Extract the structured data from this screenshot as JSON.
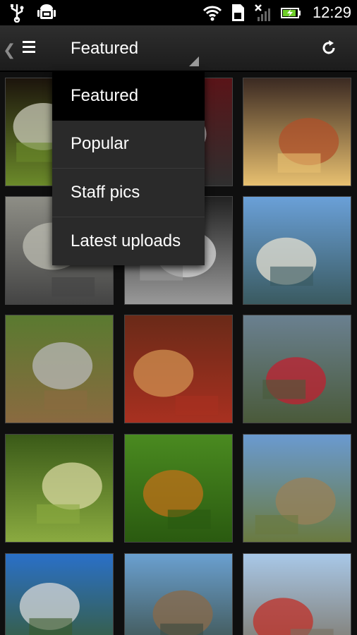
{
  "status_bar": {
    "time": "12:29",
    "icons": [
      "usb-icon",
      "android-debug-icon",
      "wifi-icon",
      "sd-card-icon",
      "signal-icon",
      "battery-charging-icon"
    ]
  },
  "action_bar": {
    "title": "Featured",
    "menu_icon": "menu-icon",
    "refresh_icon": "refresh-icon"
  },
  "dropdown": {
    "items": [
      {
        "label": "Featured",
        "selected": true
      },
      {
        "label": "Popular",
        "selected": false
      },
      {
        "label": "Staff pics",
        "selected": false
      },
      {
        "label": "Latest uploads",
        "selected": false
      }
    ]
  },
  "photos": [
    {
      "subject": "white flowers with ladybug",
      "colors": [
        "#1c140c",
        "#c9c9b8",
        "#6b8a2a"
      ]
    },
    {
      "subject": "butterfly",
      "colors": [
        "#5a1418",
        "#e8e8e8",
        "#2f2f2f"
      ]
    },
    {
      "subject": "beer on table",
      "colors": [
        "#3b2a22",
        "#b0502a",
        "#e8c070"
      ]
    },
    {
      "subject": "spider on rock",
      "colors": [
        "#8e8e86",
        "#bdbdb3",
        "#444"
      ]
    },
    {
      "subject": "angel statue",
      "colors": [
        "#222",
        "#d8d8d8",
        "#999"
      ]
    },
    {
      "subject": "boats on river",
      "colors": [
        "#6aa0d8",
        "#e6e0d0",
        "#3a5a60"
      ]
    },
    {
      "subject": "pigeon",
      "colors": [
        "#5a7a30",
        "#b8b8b8",
        "#8a6a40"
      ]
    },
    {
      "subject": "library staircase",
      "colors": [
        "#6a2a18",
        "#d09050",
        "#a83020"
      ]
    },
    {
      "subject": "red scooter",
      "colors": [
        "#6a8090",
        "#c02030",
        "#4a5a3a"
      ]
    },
    {
      "subject": "grass insect",
      "colors": [
        "#3a5a18",
        "#d8d8a0",
        "#8aaa40"
      ]
    },
    {
      "subject": "orange butterfly on leaf",
      "colors": [
        "#4a8a20",
        "#c07018",
        "#2a5a10"
      ]
    },
    {
      "subject": "stone arch",
      "colors": [
        "#6a9ad0",
        "#9a8058",
        "#6a7a40"
      ]
    },
    {
      "subject": "high-rise buildings",
      "colors": [
        "#2a70c8",
        "#d8d8d8",
        "#3a5a2a"
      ]
    },
    {
      "subject": "stilt houses on water",
      "colors": [
        "#6aa0d0",
        "#8a6a48",
        "#3a4a40"
      ]
    },
    {
      "subject": "red boat on shore",
      "colors": [
        "#a8c8e8",
        "#c03028",
        "#7a7060"
      ]
    }
  ]
}
